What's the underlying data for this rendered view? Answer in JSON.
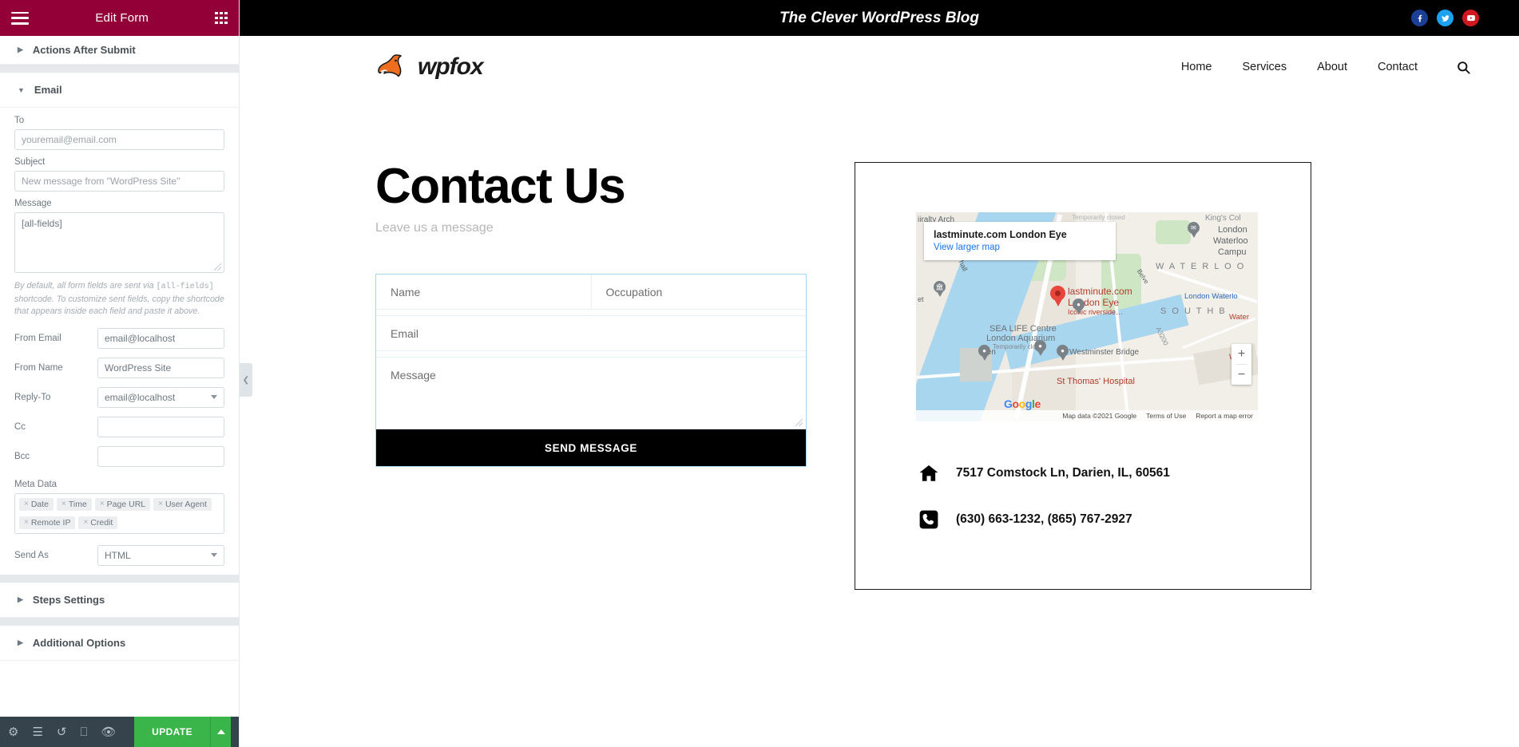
{
  "editor": {
    "header": {
      "title": "Edit Form",
      "menu_icon": "hamburger-icon",
      "widgets_icon": "grid-icon"
    },
    "sections": {
      "actions_after_submit": "Actions After Submit",
      "email": "Email",
      "steps_settings": "Steps Settings",
      "additional_options": "Additional Options"
    },
    "email": {
      "to_label": "To",
      "to_value": "youremail@email.com",
      "subject_label": "Subject",
      "subject_value": "New message from \"WordPress Site\"",
      "message_label": "Message",
      "message_value": "[all-fields]",
      "helper_a": "By default, all form fields are sent via ",
      "helper_code": "[all-fields]",
      "helper_b": " shortcode. To customize sent fields, copy the shortcode that appears inside each field and paste it above.",
      "from_email_label": "From Email",
      "from_email_value": "email@localhost",
      "from_name_label": "From Name",
      "from_name_value": "WordPress Site",
      "reply_to_label": "Reply-To",
      "reply_to_value": "email@localhost",
      "cc_label": "Cc",
      "cc_value": "",
      "bcc_label": "Bcc",
      "bcc_value": "",
      "meta_data_label": "Meta Data",
      "meta_tags": [
        "Date",
        "Time",
        "Page URL",
        "User Agent",
        "Remote IP",
        "Credit"
      ],
      "send_as_label": "Send As",
      "send_as_value": "HTML"
    },
    "footer": {
      "settings_icon": "gear-icon",
      "navigator_icon": "layers-icon",
      "history_icon": "history-icon",
      "responsive_icon": "monitor-icon",
      "preview_icon": "eye-icon",
      "update_label": "UPDATE",
      "update_caret": "caret-up-icon",
      "update_color": "#39b54a"
    },
    "collapse_handle": "chevron-left-icon",
    "accent_color": "#930038"
  },
  "site": {
    "topbar": {
      "title": "The Clever WordPress Blog",
      "socials": [
        {
          "name": "facebook-icon",
          "color": "#1b3f94"
        },
        {
          "name": "twitter-icon",
          "color": "#1da1f2"
        },
        {
          "name": "youtube-icon",
          "color": "#d0191e"
        }
      ]
    },
    "logo": {
      "wordmark": "wpfox",
      "mark": "fox-logo-icon",
      "color": "#ef6d1f"
    },
    "nav": [
      "Home",
      "Services",
      "About",
      "Contact"
    ],
    "search_icon": "search-icon"
  },
  "contact": {
    "heading": "Contact Us",
    "subheading": "Leave us a message",
    "fields": {
      "name": "Name",
      "occupation": "Occupation",
      "email": "Email",
      "message": "Message"
    },
    "submit_label": "SEND MESSAGE"
  },
  "map": {
    "infobox_title": "lastminute.com London Eye",
    "infobox_link": "View larger map",
    "marker_title": "lastminute.com",
    "marker_title2": "London Eye",
    "marker_sub": "Iconic riverside…",
    "google_logo": "Google",
    "attribution": "Map data ©2021 Google",
    "terms": "Terms of Use",
    "report": "Report a map error",
    "zoom_in": "+",
    "zoom_out": "−",
    "labels": {
      "admiralty_arch": "iiralty Arch",
      "whitehall": "hall",
      "waterloo": "W A T E R L O O",
      "southb": "S O U T H   B",
      "sealife": "SEA LIFE Centre",
      "aquarium": "London Aquarium",
      "temp_closed": "Temporarily closed",
      "westminster_bridge": "Westminster Bridge",
      "ben": "Ben",
      "kings_coll": "King's Col",
      "london": "London",
      "waterloo_campus1": "Waterloo",
      "waterloo_campus2": "Campu",
      "london_waterloo": "London Waterlo",
      "water": "Water",
      "belve": "Belve",
      "a3200": "A3200",
      "st_thomas": "St Thomas' Hospital",
      "et": "et",
      "w_label": "W",
      "temp_closed_top": "Temporarily closed"
    }
  },
  "info": {
    "address_icon": "home-icon",
    "address": "7517 Comstock Ln, Darien, IL, 60561",
    "phone_icon": "phone-icon",
    "phone": "(630) 663-1232, (865) 767-2927"
  }
}
